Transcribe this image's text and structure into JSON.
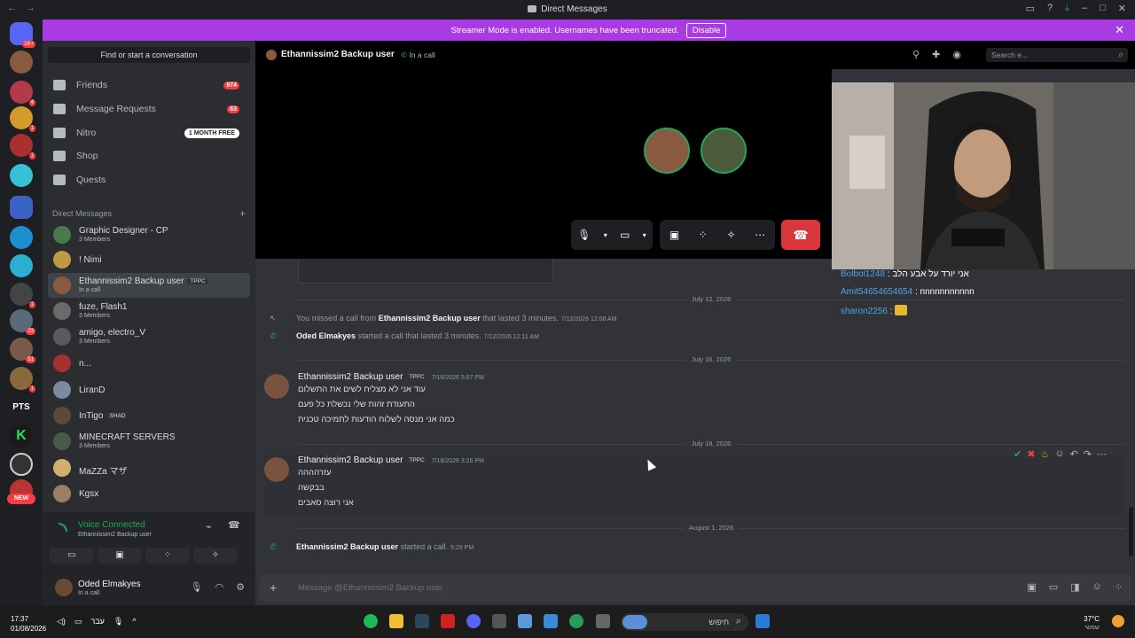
{
  "window": {
    "title": "Direct Messages"
  },
  "banner": {
    "text": "Streamer Mode is enabled. Usernames have been truncated.",
    "button": "Disable"
  },
  "servers": {
    "badge_top": "1K+",
    "new_label": "NEW",
    "labels": [
      "PTS"
    ]
  },
  "sidebar": {
    "find_placeholder": "Find or start a conversation",
    "nav": [
      {
        "label": "Friends",
        "count": "974"
      },
      {
        "label": "Message Requests",
        "count": "63"
      },
      {
        "label": "Nitro",
        "pill": "1 MONTH FREE"
      },
      {
        "label": "Shop"
      },
      {
        "label": "Quests"
      }
    ],
    "dm_header": "Direct Messages",
    "dms": [
      {
        "name": "Graphic Designer - CP",
        "sub": "3 Members"
      },
      {
        "name": "! Nimi"
      },
      {
        "name": "Ethannissim2 Backup user",
        "tag": "TPPC",
        "sub": "In a call"
      },
      {
        "name": "fuze, Flash1",
        "sub": "3 Members"
      },
      {
        "name": "amigo, electro_V",
        "sub": "3 Members"
      },
      {
        "name": "n..."
      },
      {
        "name": "LiranD"
      },
      {
        "name": "InTigo",
        "tag": "SHAD"
      },
      {
        "name": "MINECRAFT SERVERS",
        "sub": "3 Members"
      },
      {
        "name": "MaZZa マザ"
      },
      {
        "name": "Kgsx"
      }
    ],
    "voice": {
      "status": "Voice Connected",
      "channel": "Ethannissim2 Backup user"
    },
    "user": {
      "name": "Oded Elmakyes",
      "status": "In a call"
    }
  },
  "header": {
    "name": "Ethannissim2 Backup user",
    "status": "In a call",
    "search_placeholder": "Search e..."
  },
  "overlay_chat": [
    {
      "user": "Bolbol1248",
      "text": "אני יורד על אבע הלב"
    },
    {
      "user": "Amit54654654654",
      "text": "nnnnnnnnnnn"
    },
    {
      "user": "sharon2256",
      "text": ""
    }
  ],
  "messages": {
    "dividers": [
      "July 12, 2026",
      "July 16, 2026",
      "July 18, 2026",
      "August 1, 2026"
    ],
    "missed": {
      "pre": "You missed a call from",
      "who": "Ethannissim2 Backup user",
      "post": "that lasted 3 minutes.",
      "time": "7/12/2026 12:08 AM"
    },
    "started1": {
      "who": "Oded Elmakyes",
      "post": "started a call that lasted 3 minutes.",
      "time": "7/12/2026 12:11 AM"
    },
    "group1": {
      "author": "Ethannissim2 Backup user",
      "tag": "TPPC",
      "time": "7/16/2026 5:07 PM",
      "lines": [
        "עוד אני לא מצליח לשים את התשלום",
        "התעודת זהות שלי נכשלת כל פעם",
        "כמה אני מנסה לשלוח הודעות לתמיכה טכנית"
      ]
    },
    "group2": {
      "author": "Ethannissim2 Backup user",
      "tag": "TPPC",
      "time": "7/18/2026 3:26 PM",
      "lines": [
        "עזרהההה",
        "בבקשה",
        "אני רוצה סאבים"
      ]
    },
    "started2": {
      "who": "Ethannissim2 Backup user",
      "post": "started a call.",
      "time": "5:29 PM"
    }
  },
  "composer": {
    "placeholder": "Message @Ethannissim2 Backup user"
  },
  "taskbar": {
    "time": "17:37",
    "date": "01/08/2026",
    "lang": "עבר",
    "search": "חיפוש",
    "temp": "37°C",
    "cond": "שמשי"
  },
  "colors": {
    "accent": "#a93be5",
    "green": "#23a55a",
    "red": "#da373c"
  }
}
